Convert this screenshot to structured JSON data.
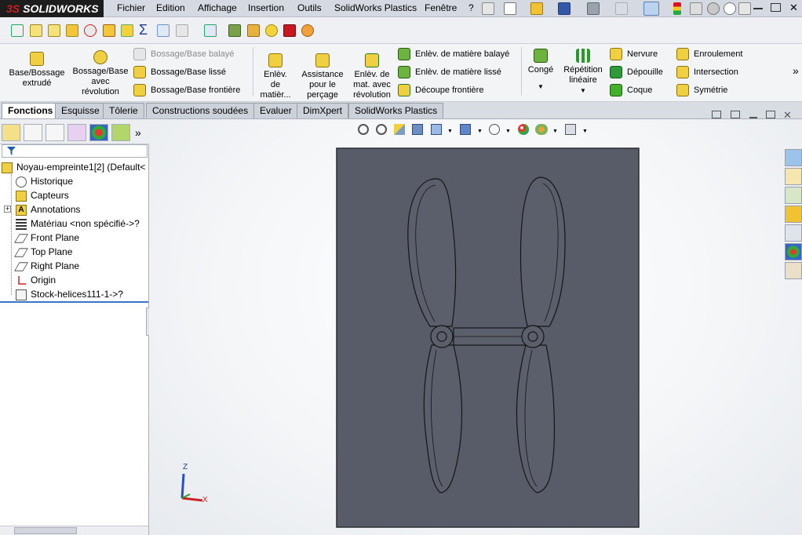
{
  "app": {
    "brand_prefix": "3S",
    "brand": "SOLIDWORKS"
  },
  "menu": [
    "Fichier",
    "Edition",
    "Affichage",
    "Insertion",
    "Outils",
    "SolidWorks Plastics",
    "Fenêtre",
    "?"
  ],
  "ribbon": {
    "big": [
      {
        "label": "Base/Bossage\nextrudé",
        "icon": "extruded-boss-icon"
      },
      {
        "label": "Bossage/Base\navec\nrévolution",
        "icon": "revolved-boss-icon"
      }
    ],
    "small1": [
      {
        "label": "Bossage/Base balayé",
        "icon": "swept-boss-icon",
        "disabled": true
      },
      {
        "label": "Bossage/Base lissé",
        "icon": "lofted-boss-icon"
      },
      {
        "label": "Bossage/Base frontière",
        "icon": "boundary-boss-icon"
      }
    ],
    "big2": [
      {
        "label": "Enlèv.\nde\nmatièr...",
        "icon": "extruded-cut-icon"
      },
      {
        "label": "Assistance\npour le\nperçage",
        "icon": "hole-wizard-icon"
      },
      {
        "label": "Enlèv. de\nmat. avec\nrévolution",
        "icon": "revolved-cut-icon"
      }
    ],
    "small2": [
      {
        "label": "Enlèv. de matière balayé",
        "icon": "swept-cut-icon"
      },
      {
        "label": "Enlèv. de matière lissé",
        "icon": "lofted-cut-icon"
      },
      {
        "label": "Découpe frontière",
        "icon": "boundary-cut-icon"
      }
    ],
    "big3": [
      {
        "label": "Congé",
        "icon": "fillet-icon"
      },
      {
        "label": "Répétition\nlinéaire",
        "icon": "linear-pattern-icon"
      }
    ],
    "small3": [
      {
        "label": "Nervure",
        "icon": "rib-icon"
      },
      {
        "label": "Dépouille",
        "icon": "draft-icon"
      },
      {
        "label": "Coque",
        "icon": "shell-icon"
      }
    ],
    "small4": [
      {
        "label": "Enroulement",
        "icon": "wrap-icon"
      },
      {
        "label": "Intersection",
        "icon": "intersect-icon"
      },
      {
        "label": "Symétrie",
        "icon": "mirror-icon"
      }
    ],
    "more": "»"
  },
  "tabs": [
    {
      "label": "Fonctions",
      "active": true
    },
    {
      "label": "Esquisse"
    },
    {
      "label": "Tôlerie"
    },
    {
      "label": "Constructions soudées"
    },
    {
      "label": "Evaluer"
    },
    {
      "label": "DimXpert"
    },
    {
      "label": "SolidWorks Plastics"
    }
  ],
  "feature_manager": {
    "more": "»",
    "root": "Noyau-empreinte1[2]  (Default<",
    "items": [
      {
        "label": "Historique",
        "icon": "history-icon"
      },
      {
        "label": "Capteurs",
        "icon": "sensors-icon"
      },
      {
        "label": "Annotations",
        "icon": "annotations-icon",
        "expandable": true
      },
      {
        "label": "Matériau <non spécifié->?",
        "icon": "material-icon"
      },
      {
        "label": "Front Plane",
        "icon": "plane-icon"
      },
      {
        "label": "Top Plane",
        "icon": "plane-icon"
      },
      {
        "label": "Right Plane",
        "icon": "plane-icon"
      },
      {
        "label": "Origin",
        "icon": "origin-icon"
      },
      {
        "label": "Stock-helices111-1->?",
        "icon": "part-icon"
      }
    ]
  },
  "triad": {
    "z": "Z",
    "x": "X"
  },
  "colors": {
    "model": "#555a66",
    "edge": "#1a1a1a",
    "accent": "#cc1f1f"
  }
}
